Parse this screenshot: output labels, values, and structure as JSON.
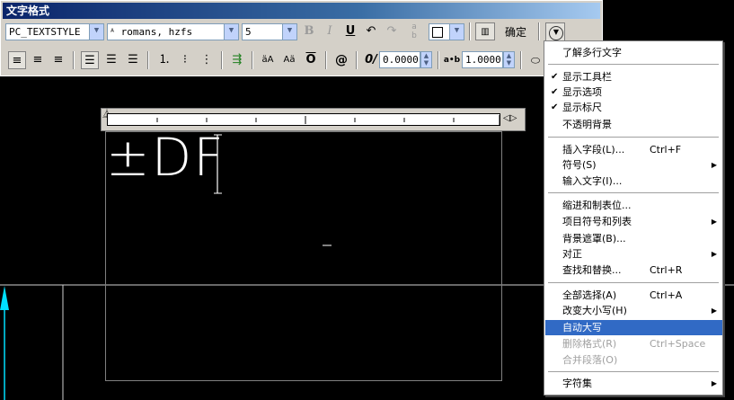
{
  "window": {
    "title": "文字格式",
    "style_value": "PC_TEXTSTYLE",
    "font_value": "romans, hzfs",
    "height_value": "5",
    "ok_label": "确定",
    "bold_label": "B",
    "italic_label": "I",
    "underline_label": "U",
    "oblique_value": "0.0000",
    "tracking_value": "1.0000",
    "tracking_label": "a•b",
    "at_label": "@",
    "oblique_label": "0/"
  },
  "editor": {
    "text": "±DF"
  },
  "menu": {
    "items": [
      {
        "label": "了解多行文字"
      },
      {
        "label": "显示工具栏",
        "checked": "✔"
      },
      {
        "label": "显示选项",
        "checked": "✔"
      },
      {
        "label": "显示标尺",
        "checked": "✔"
      },
      {
        "label": "不透明背景"
      },
      {
        "label": "插入字段(L)...",
        "shortcut": "Ctrl+F"
      },
      {
        "label": "符号(S)",
        "arrow": "▶"
      },
      {
        "label": "输入文字(I)..."
      },
      {
        "label": "缩进和制表位..."
      },
      {
        "label": "项目符号和列表",
        "arrow": "▶"
      },
      {
        "label": "背景遮罩(B)..."
      },
      {
        "label": "对正",
        "arrow": "▶"
      },
      {
        "label": "查找和替换...",
        "shortcut": "Ctrl+R"
      },
      {
        "label": "全部选择(A)",
        "shortcut": "Ctrl+A"
      },
      {
        "label": "改变大小写(H)",
        "arrow": "▶"
      },
      {
        "label": "自动大写"
      },
      {
        "label": "删除格式(R)",
        "shortcut": "Ctrl+Space"
      },
      {
        "label": "合并段落(O)"
      },
      {
        "label": "字符集",
        "arrow": "▶"
      }
    ]
  },
  "colors": {
    "titlebar": "#0a246a",
    "highlight": "#316ac5",
    "canvas": "#000000",
    "cyan_arrow": "#00e0ff"
  }
}
